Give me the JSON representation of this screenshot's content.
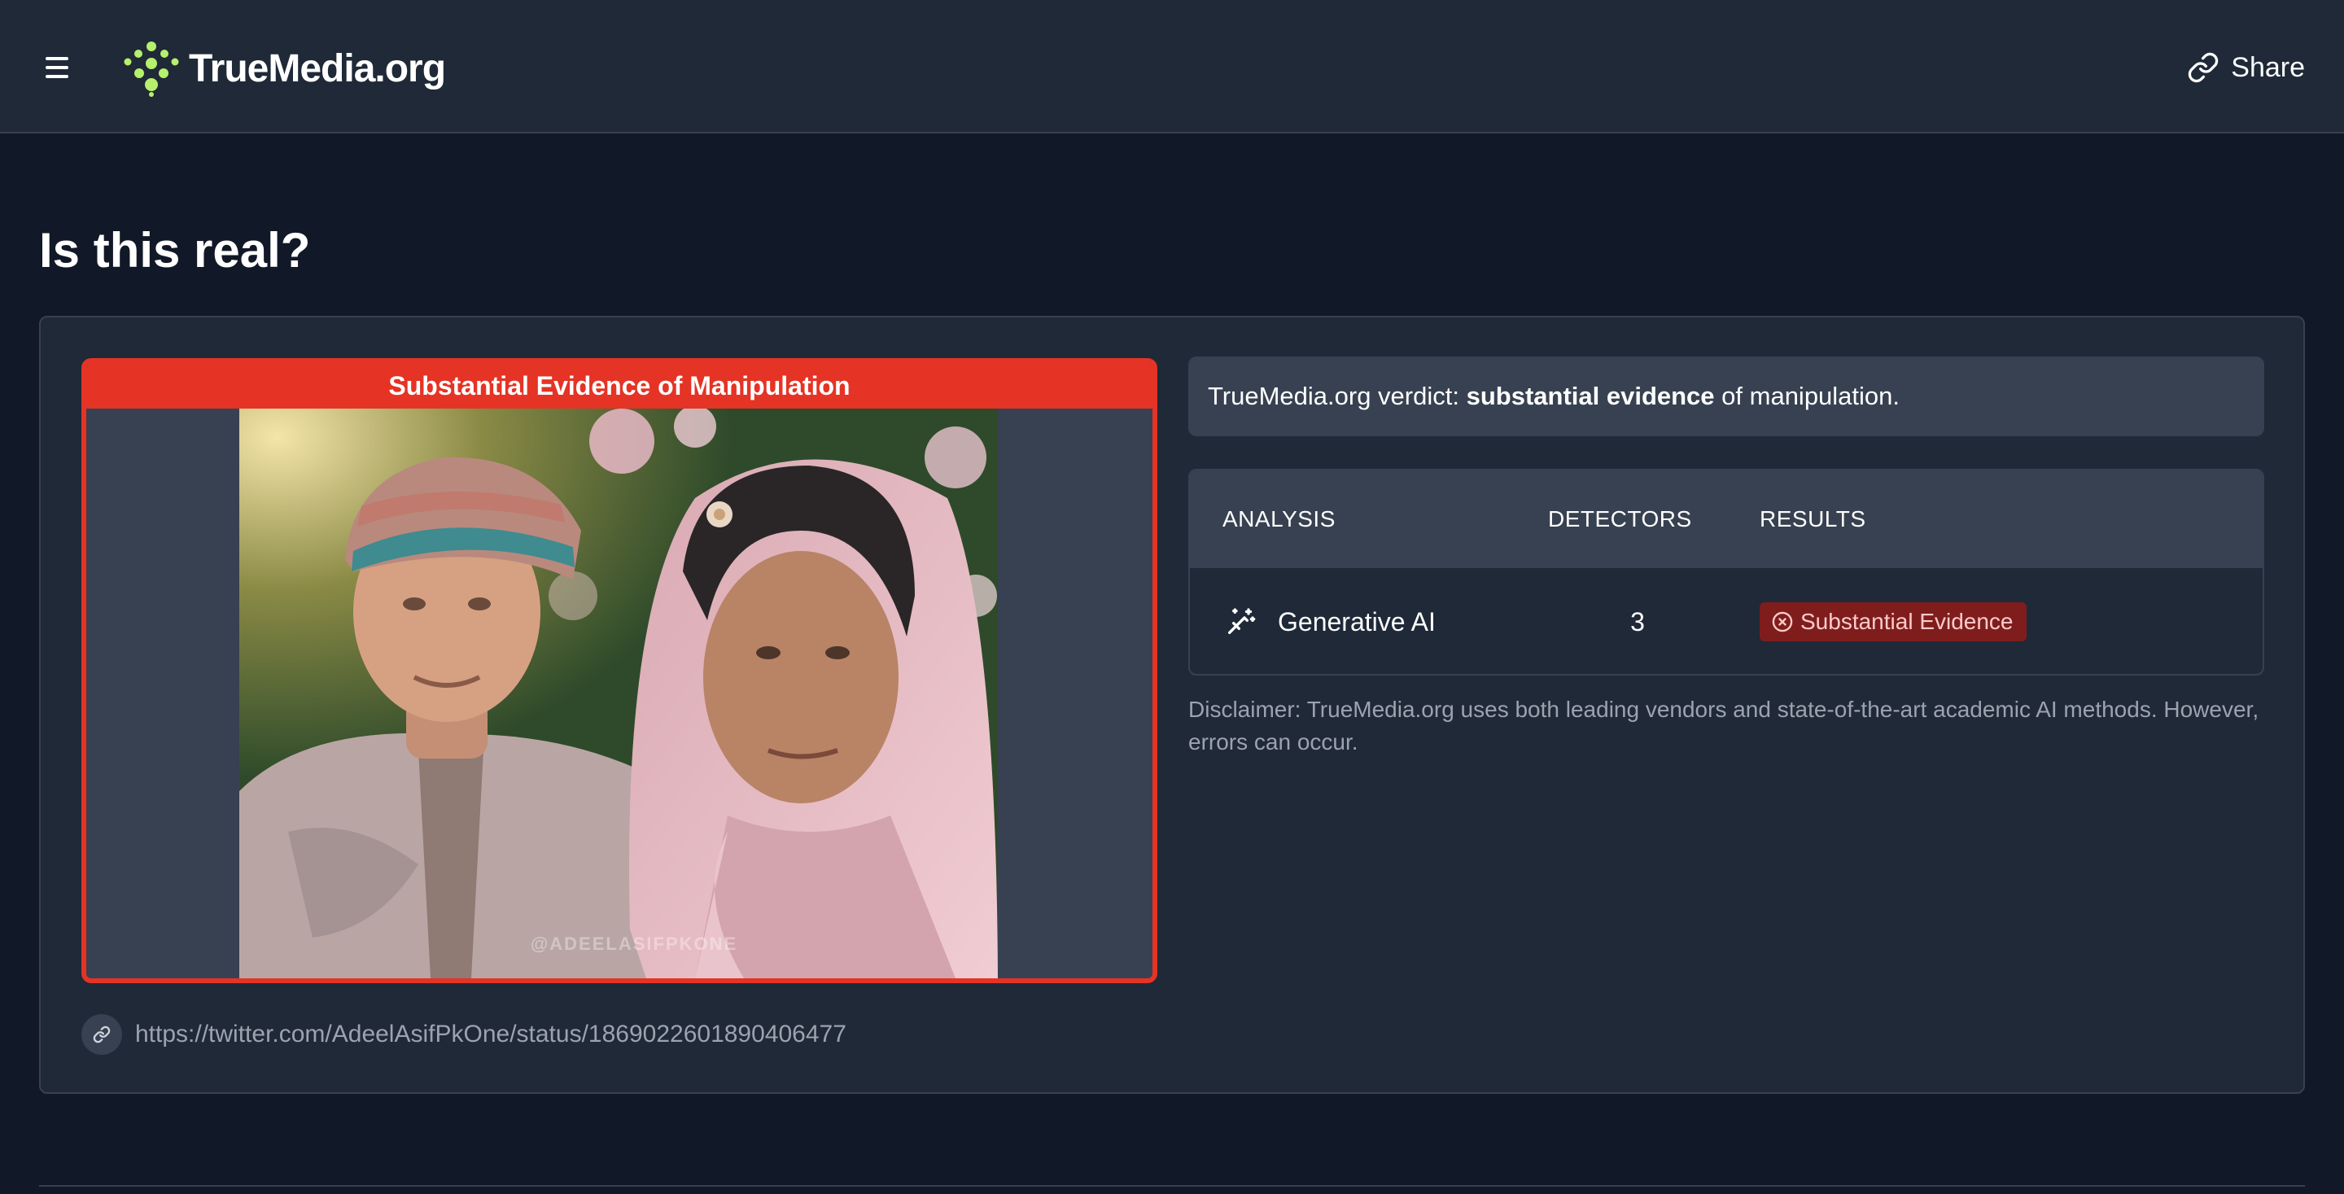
{
  "header": {
    "brand": "TrueMedia.org",
    "share_label": "Share",
    "icons": {
      "menu": "menu-icon",
      "logo": "logo-dots-icon",
      "share": "link-icon"
    }
  },
  "page": {
    "title": "Is this real?"
  },
  "media": {
    "banner": "Substantial Evidence of Manipulation",
    "watermark": "@ADEELASIFPKONE",
    "url": "https://twitter.com/AdeelAsifPkOne/status/1869022601890406477"
  },
  "verdict": {
    "prefix": "TrueMedia.org verdict: ",
    "emphasis": "substantial evidence",
    "suffix": " of manipulation."
  },
  "analysis_table": {
    "headers": [
      "ANALYSIS",
      "DETECTORS",
      "RESULTS"
    ],
    "rows": [
      {
        "analysis": "Generative AI",
        "detectors": "3",
        "result": "Substantial Evidence",
        "icon": "magic-wand-icon",
        "result_icon": "x-circle-icon"
      }
    ]
  },
  "disclaimer": "Disclaimer: TrueMedia.org uses both leading vendors and state-of-the-art academic AI methods. However, errors can occur.",
  "colors": {
    "page_bg": "#111827",
    "card_bg": "#1f2937",
    "panel_bg": "#374151",
    "alert_red": "#e53325",
    "badge_bg": "#7f1d1d",
    "badge_text": "#fecaca",
    "logo_green": "#b6f06c",
    "muted_text": "#9ca3af"
  }
}
